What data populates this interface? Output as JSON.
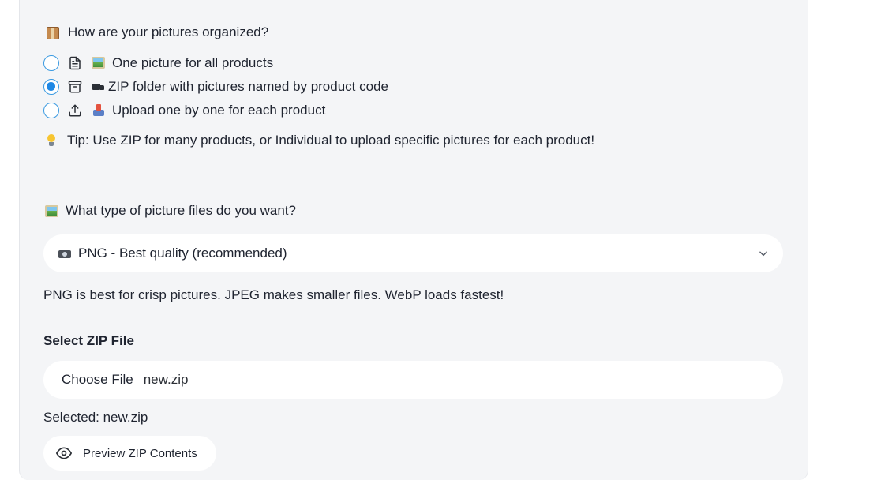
{
  "organization": {
    "heading": "How are your pictures organized?",
    "heading_icon": "package-emoji",
    "options": [
      {
        "label": "One picture for all products",
        "icon": "file-text-icon",
        "emoji": "framed-picture-emoji",
        "selected": false
      },
      {
        "label": "ZIP folder with pictures named by product code",
        "icon": "archive-icon",
        "emoji": "truck-emoji",
        "selected": true
      },
      {
        "label": "Upload one by one for each product",
        "icon": "upload-icon",
        "emoji": "outbox-tray-emoji",
        "selected": false
      }
    ],
    "tip": "Tip: Use ZIP for many products, or Individual to upload specific pictures for each product!"
  },
  "file_type": {
    "heading": "What type of picture files do you want?",
    "heading_icon": "framed-picture-emoji",
    "selected_value": "PNG - Best quality (recommended)",
    "selected_icon": "camera-emoji",
    "help": "PNG is best for crisp pictures. JPEG makes smaller files. WebP loads fastest!"
  },
  "zip_upload": {
    "label": "Select ZIP File",
    "choose_label": "Choose File",
    "file_name": "new.zip",
    "selected_text": "Selected: new.zip",
    "preview_label": "Preview ZIP Contents",
    "preview_icon": "eye-icon"
  },
  "colors": {
    "accent": "#1e88e5",
    "panel": "#f4f5f7",
    "text": "#1f2430"
  }
}
